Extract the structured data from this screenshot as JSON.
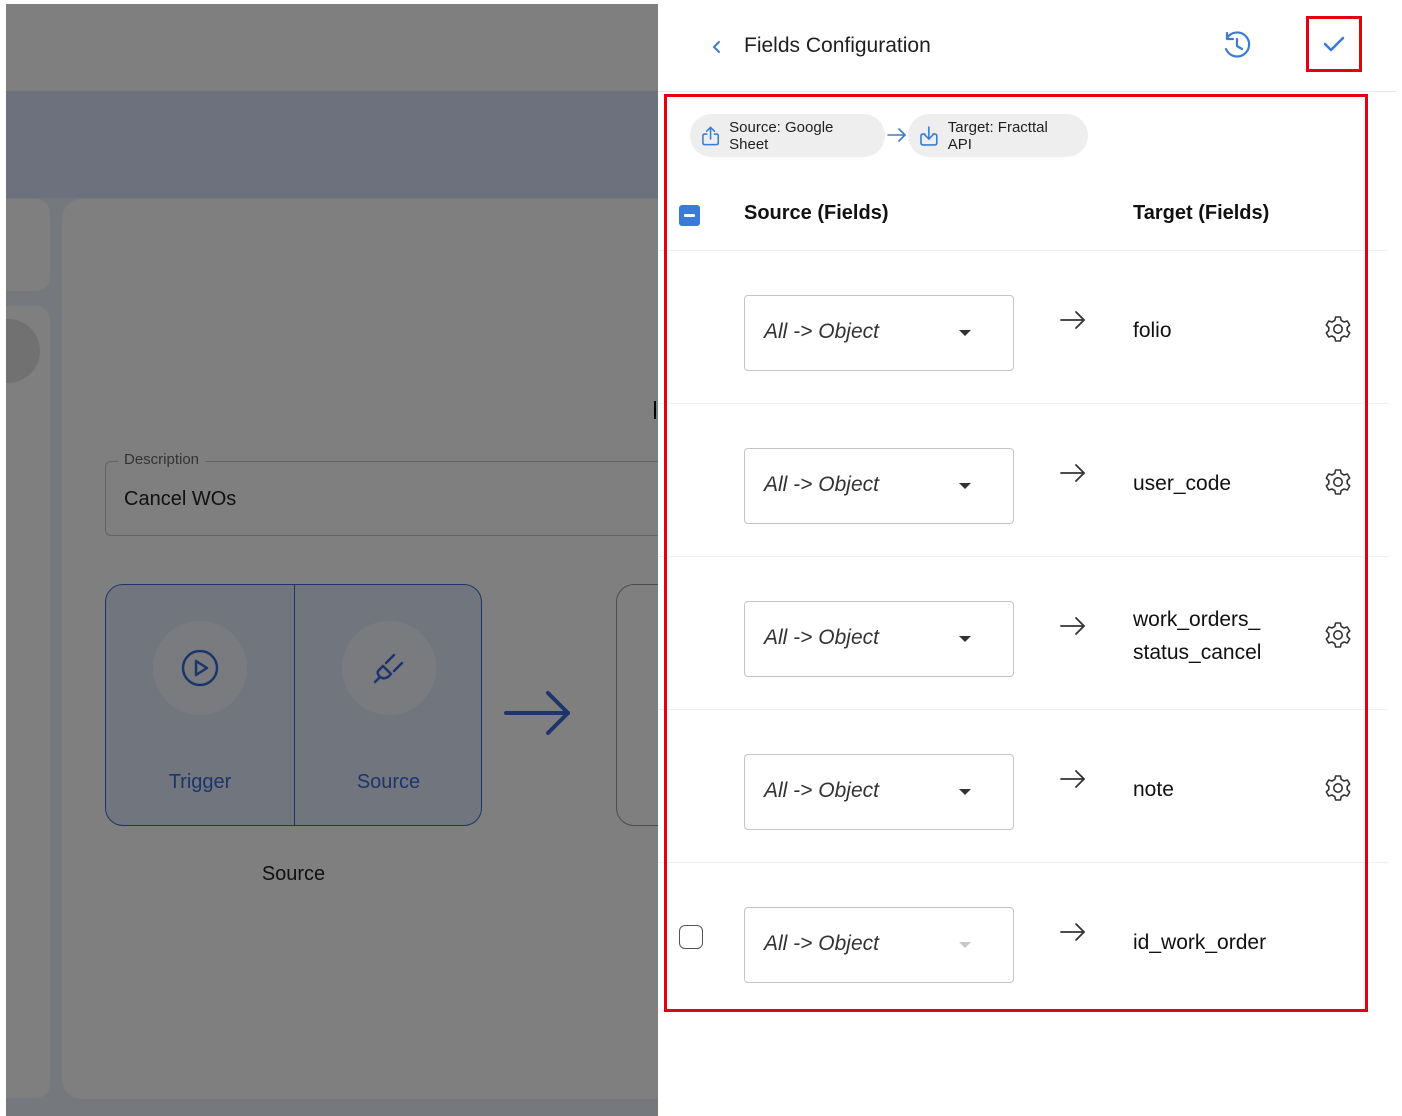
{
  "background": {
    "description_label": "Description",
    "description_value": "Cancel WOs",
    "steps": [
      {
        "label": "Trigger",
        "icon": "play-circle-icon"
      },
      {
        "label": "Source",
        "icon": "plug-icon"
      }
    ],
    "source_caption": "Source"
  },
  "drawer": {
    "title": "Fields Configuration",
    "chips": {
      "source": "Source: Google Sheet",
      "target": "Target: Fracttal API"
    },
    "columns": {
      "source": "Source (Fields)",
      "target": "Target (Fields)"
    },
    "rows": [
      {
        "source": "All -> Object",
        "target": "folio",
        "has_checkbox": false,
        "has_settings": true
      },
      {
        "source": "All -> Object",
        "target": "user_code",
        "has_checkbox": false,
        "has_settings": true
      },
      {
        "source": "All -> Object",
        "target_line1": "work_orders_",
        "target_line2": "status_cancel",
        "has_checkbox": false,
        "has_settings": true
      },
      {
        "source": "All -> Object",
        "target": "note",
        "has_checkbox": false,
        "has_settings": true
      },
      {
        "source": "All -> Object",
        "target": "id_work_order",
        "has_checkbox": true,
        "has_settings": false,
        "select_disabled": true
      }
    ]
  },
  "colors": {
    "accent": "#3a7bd5",
    "highlight": "#e3000f",
    "step_border": "#3a6ad6"
  }
}
